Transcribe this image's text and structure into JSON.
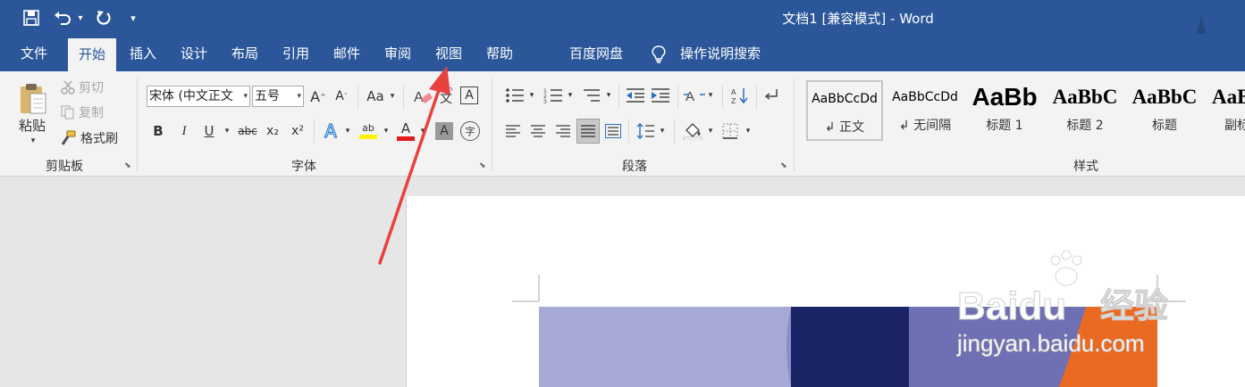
{
  "title_bar": {
    "title": "文档1 [兼容模式]  -  Word"
  },
  "quick_access": {
    "customize_glyph": "▾"
  },
  "tabs": [
    {
      "label": "文件",
      "active": false
    },
    {
      "label": "开始",
      "active": true
    },
    {
      "label": "插入",
      "active": false
    },
    {
      "label": "设计",
      "active": false
    },
    {
      "label": "布局",
      "active": false
    },
    {
      "label": "引用",
      "active": false
    },
    {
      "label": "邮件",
      "active": false
    },
    {
      "label": "审阅",
      "active": false
    },
    {
      "label": "视图",
      "active": false
    },
    {
      "label": "帮助",
      "active": false
    },
    {
      "label": "百度网盘",
      "active": false
    }
  ],
  "tell_me": {
    "label": "操作说明搜索"
  },
  "clipboard": {
    "paste_label": "粘贴",
    "cut_label": "剪切",
    "copy_label": "复制",
    "format_painter_label": "格式刷",
    "group_label": "剪贴板"
  },
  "font": {
    "font_name": "宋体 (中文正文",
    "font_size": "五号",
    "grow": "A",
    "shrink": "A",
    "change_case": "Aa",
    "phonetic_top": "wén",
    "phonetic_char": "文",
    "border_char": "A",
    "bold": "B",
    "italic": "I",
    "underline": "U",
    "strike": "abc",
    "subscript": "x₂",
    "superscript": "x²",
    "effects": "A",
    "highlight": "ab",
    "font_color": "A",
    "shading": "A",
    "enclose": "字",
    "group_label": "字体"
  },
  "paragraph": {
    "group_label": "段落"
  },
  "styles": {
    "items": [
      {
        "preview": "AaBbCcDd",
        "name": "↲ 正文",
        "selected": true
      },
      {
        "preview": "AaBbCcDd",
        "name": "↲ 无间隔",
        "selected": false
      },
      {
        "preview": "AaBb",
        "name": "标题 1",
        "selected": false
      },
      {
        "preview": "AaBbC",
        "name": "标题 2",
        "selected": false
      },
      {
        "preview": "AaBbC",
        "name": "标题",
        "selected": false
      },
      {
        "preview": "AaB",
        "name": "副标",
        "selected": false
      }
    ],
    "group_label": "样式"
  },
  "watermark": {
    "brand": "Baidu",
    "jingyan": "经验",
    "url": "jingyan.baidu.com"
  },
  "colors": {
    "title_bg": "#2b579a",
    "ribbon_bg": "#f3f3f3",
    "arrow": "#e8413e",
    "font_color_bar": "#e31b1b",
    "highlight_bar": "#fff200",
    "image_lavender": "#a7a9d6",
    "image_navy": "#1b2466",
    "image_purple": "#6f6fb4",
    "image_orange": "#ea6a21"
  }
}
